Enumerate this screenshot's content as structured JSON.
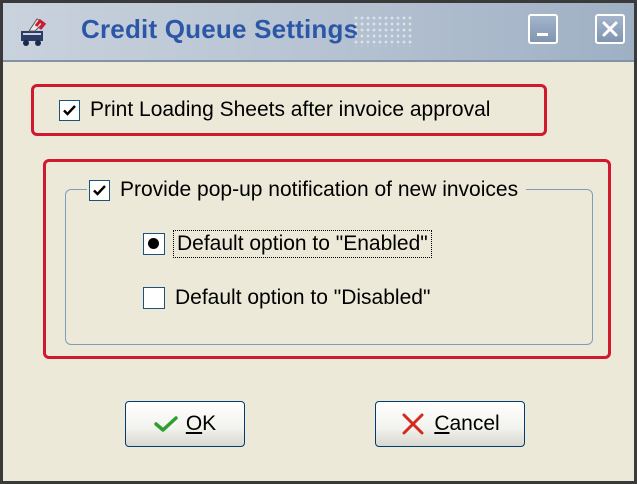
{
  "window": {
    "title": "Credit Queue Settings",
    "icon": "credit-queue-app-icon",
    "controls": {
      "minimize_icon": "minimize-icon",
      "close_icon": "close-icon"
    }
  },
  "options": {
    "print_loading_sheets": {
      "label": "Print Loading Sheets after invoice approval",
      "checked": true
    },
    "popup_notification": {
      "label": "Provide pop-up notification of new invoices",
      "checked": true,
      "default_options": [
        {
          "label": "Default option to \"Enabled\"",
          "selected": true
        },
        {
          "label": "Default option to \"Disabled\"",
          "selected": false
        }
      ]
    }
  },
  "buttons": {
    "ok": {
      "mnemonic": "O",
      "rest": "K",
      "icon": "checkmark-icon"
    },
    "cancel": {
      "mnemonic": "C",
      "rest": "ancel",
      "icon": "x-icon"
    }
  },
  "colors": {
    "highlight": "#d0182e",
    "title_text": "#2c57a6",
    "ok_icon": "#2e9e2e",
    "cancel_icon": "#d42a1e"
  }
}
